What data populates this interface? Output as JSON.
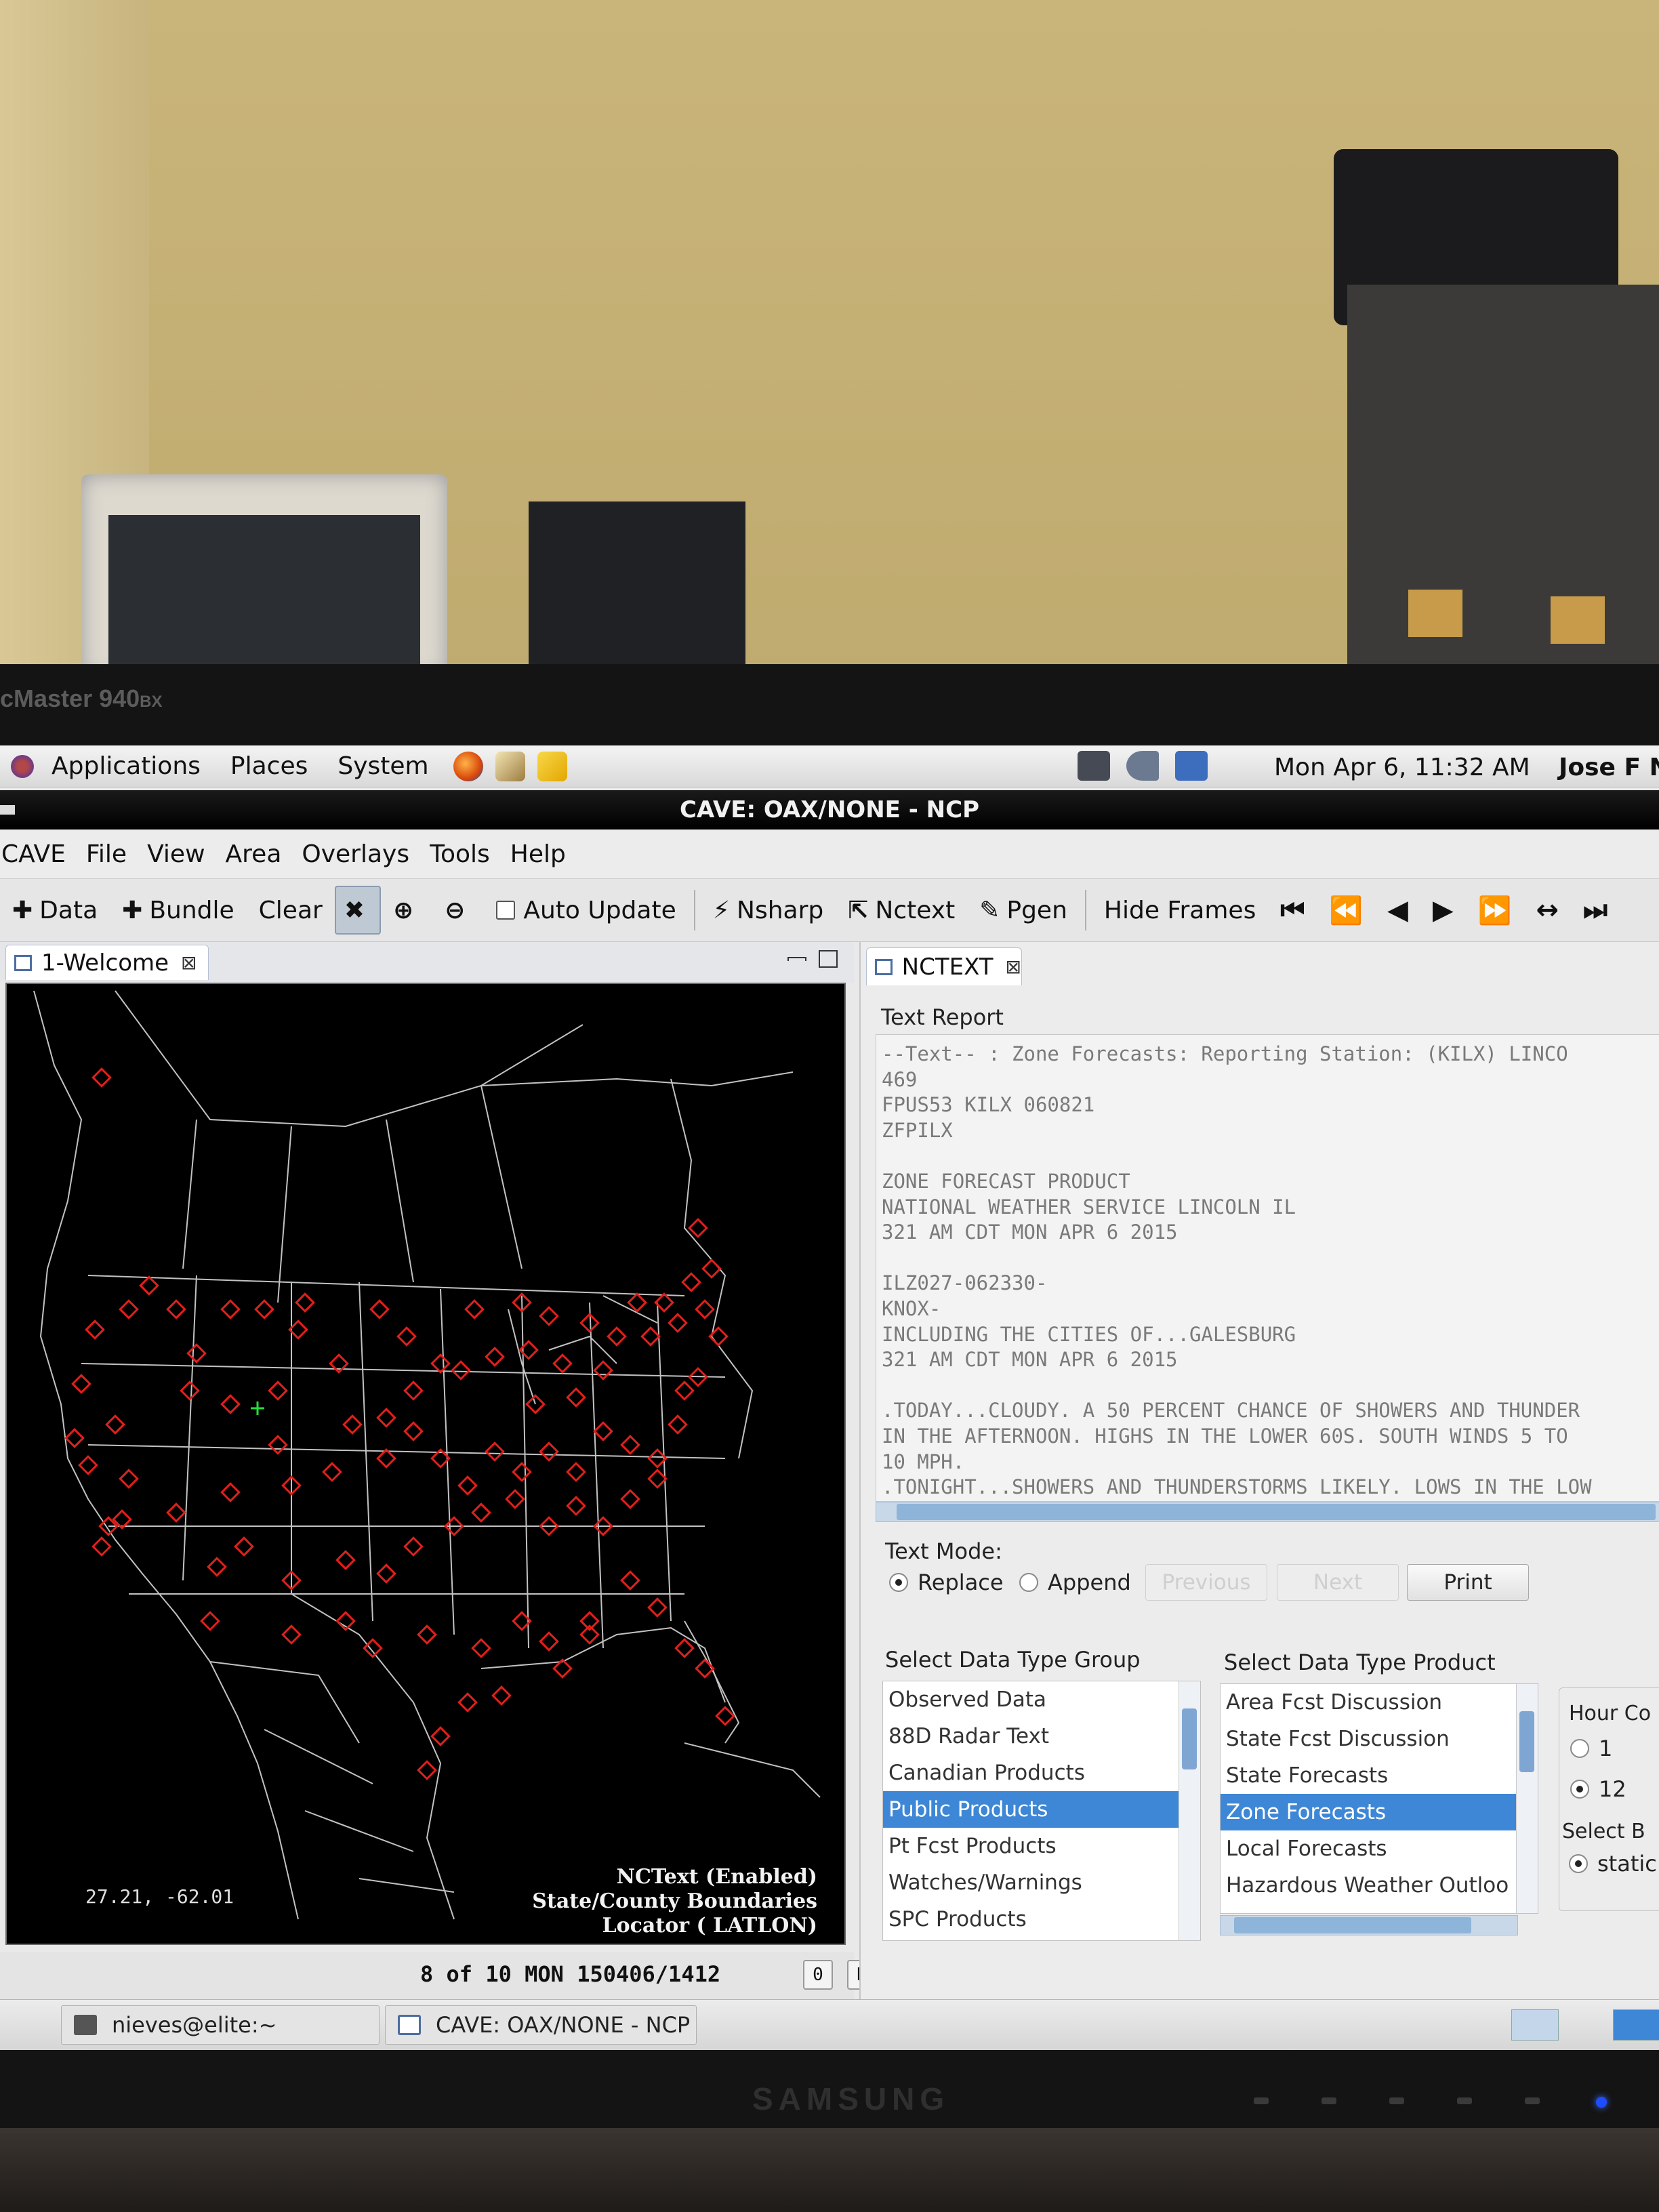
{
  "monitor": {
    "model_partial": "cMaster 940",
    "model_suffix": "BX",
    "brand": "SAMSUNG"
  },
  "gnome_panel": {
    "menus": [
      "Applications",
      "Places",
      "System"
    ],
    "launchers": [
      "firefox-icon",
      "mail-icon",
      "notes-icon"
    ],
    "clock": "Mon Apr  6, 11:32 AM",
    "user": "Jose F N"
  },
  "window": {
    "title": "CAVE: OAX/NONE - NCP"
  },
  "app_menu": [
    "CAVE",
    "File",
    "View",
    "Area",
    "Overlays",
    "Tools",
    "Help"
  ],
  "toolbar": {
    "data_label": "Data",
    "bundle_label": "Bundle",
    "clear_label": "Clear",
    "auto_update_label": "Auto Update",
    "nsharp_label": "Nsharp",
    "nctext_label": "Nctext",
    "pgen_label": "Pgen",
    "hide_frames_label": "Hide Frames",
    "nav_icons": [
      "first-frame-icon",
      "step-back-fast-icon",
      "step-back-icon",
      "step-forward-icon",
      "step-forward-fast-icon",
      "loop-icon",
      "last-frame-icon"
    ]
  },
  "map_pane": {
    "tab_label": "1-Welcome",
    "readout": "27.21, -62.01",
    "legend": [
      "NCText (Enabled)",
      "State/County Boundaries",
      "Locator ( LATLON)"
    ],
    "frame_status": "8 of 10  MON 150406/1412",
    "frame_box_1": "0",
    "frame_box_2": "N",
    "slider_position_fraction": 0.45
  },
  "nctext_pane": {
    "tab_label": "NCTEXT",
    "text_report_label": "Text Report",
    "report_lines": [
      "--Text-- : Zone Forecasts: Reporting Station: (KILX) LINCO",
      "469",
      "FPUS53 KILX 060821",
      "ZFPILX",
      "",
      "ZONE FORECAST PRODUCT",
      "NATIONAL WEATHER SERVICE LINCOLN IL",
      "321 AM CDT MON APR 6 2015",
      "",
      "ILZ027-062330-",
      "KNOX-",
      "INCLUDING THE CITIES OF...GALESBURG",
      "321 AM CDT MON APR 6 2015",
      "",
      ".TODAY...CLOUDY. A 50 PERCENT CHANCE OF SHOWERS AND THUNDER",
      "IN THE AFTERNOON. HIGHS IN THE LOWER 60S. SOUTH WINDS 5 TO",
      "10 MPH.",
      ".TONIGHT...SHOWERS AND THUNDERSTORMS LIKELY. LOWS IN THE LOW"
    ],
    "text_mode_label": "Text Mode:",
    "replace_label": "Replace",
    "append_label": "Append",
    "previous_label": "Previous",
    "next_label": "Next",
    "print_label": "Print",
    "group_list_label": "Select Data Type Group",
    "group_list": [
      "Observed Data",
      "88D Radar Text",
      "Canadian Products",
      "Public Products",
      "Pt Fcst Products",
      "Watches/Warnings",
      "SPC Products"
    ],
    "group_selected_index": 3,
    "product_list_label": "Select Data Type Product",
    "product_list": [
      "Area Fcst Discussion",
      "State Fcst Discussion",
      "State Forecasts",
      "Zone Forecasts",
      "Local Forecasts",
      "Hazardous Weather Outloo"
    ],
    "product_selected_index": 3,
    "hour_label": "Hour Co",
    "hour_options": [
      "1",
      "12"
    ],
    "hour_selected": "12",
    "select_b_label": "Select B",
    "station_option": "static"
  },
  "taskbar": {
    "items": [
      "nieves@elite:~",
      "CAVE: OAX/NONE - NCP"
    ]
  },
  "colors": {
    "marker": "#e0201c",
    "selection": "#3e87d6",
    "map_bg": "#000000",
    "map_lines": "#c7c7c7"
  }
}
